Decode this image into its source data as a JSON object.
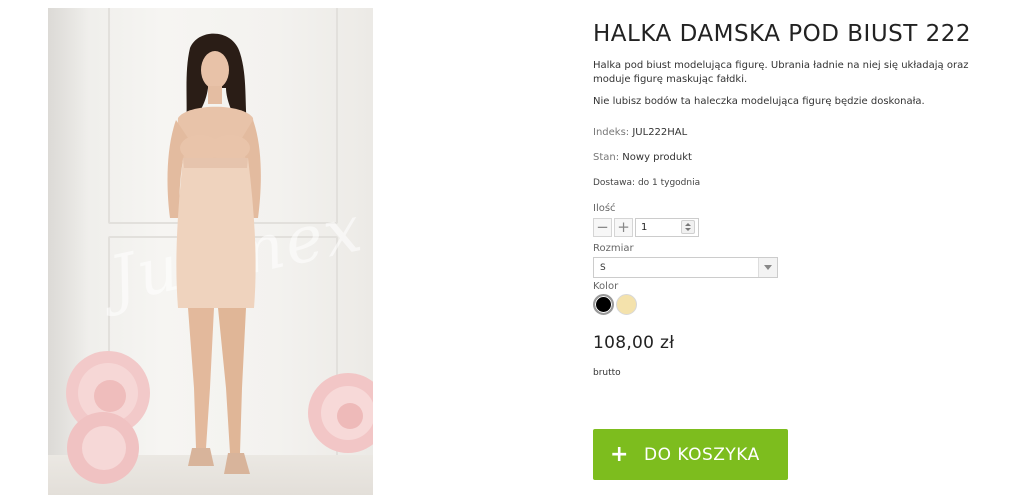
{
  "product": {
    "title": "HALKA DAMSKA POD BIUST 222",
    "description_1": "Halka pod biust modelująca figurę. Ubrania ładnie na niej się układają oraz moduje figurę maskując fałdki.",
    "description_2": "Nie lubisz bodów ta haleczka modelująca figurę będzie doskonała.",
    "image_watermark": "Julimex"
  },
  "meta": {
    "index_label": "Indeks:",
    "index_value": "JUL222HAL",
    "condition_label": "Stan:",
    "condition_value": "Nowy produkt",
    "delivery": "Dostawa: do 1 tygodnia"
  },
  "quantity": {
    "label": "Ilość",
    "value": "1",
    "minus_icon": "minus-icon",
    "plus_icon": "plus-icon"
  },
  "size": {
    "label": "Rozmiar",
    "selected": "S"
  },
  "color": {
    "label": "Kolor",
    "swatches": [
      {
        "name": "black",
        "hex": "#000000"
      },
      {
        "name": "nude",
        "hex": "#f4e2ac"
      }
    ]
  },
  "pricing": {
    "price": "108,00 zł",
    "tax_note": "brutto"
  },
  "cart": {
    "icon": "+",
    "label": "DO KOSZYKA",
    "accent": "#7dbd1e"
  }
}
